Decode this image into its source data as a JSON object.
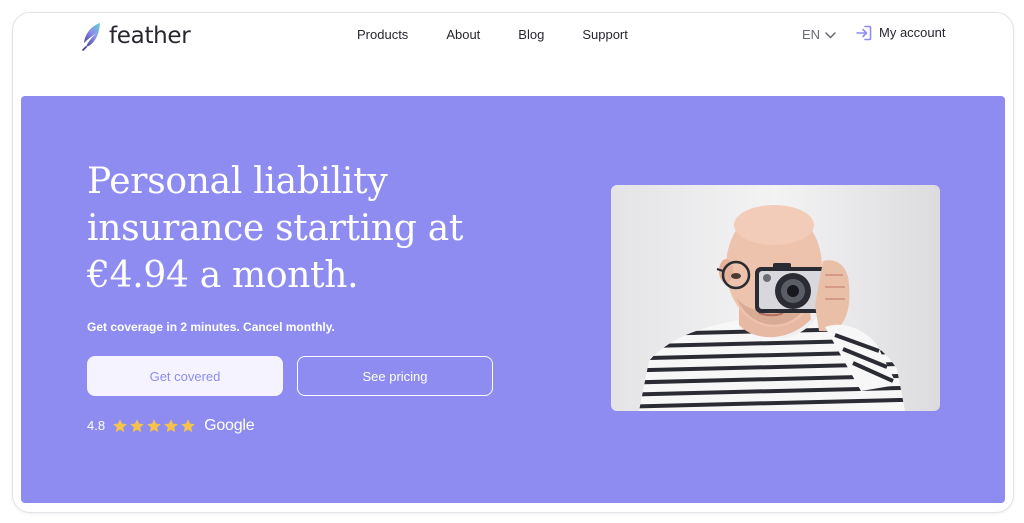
{
  "brand": {
    "name": "feather"
  },
  "nav": {
    "items": [
      {
        "label": "Products"
      },
      {
        "label": "About"
      },
      {
        "label": "Blog"
      },
      {
        "label": "Support"
      }
    ],
    "language": "EN",
    "account_label": "My account"
  },
  "hero": {
    "headline": "Personal liability insurance starting at €4.94 a month.",
    "subtitle": "Get coverage in 2 minutes. Cancel monthly.",
    "primary_button": "Get covered",
    "secondary_button": "See pricing",
    "rating": {
      "value": "4.8",
      "stars": 5,
      "source": "Google"
    },
    "image": {
      "subject": "man-with-camera-photo"
    }
  },
  "colors": {
    "brand_purple": "#8e8cf1",
    "hero_background": "#8e8cf1",
    "primary_button_bg": "#f4f3ff",
    "star": "#f5c24b",
    "text_dark": "#26262e"
  },
  "icons": [
    "feather-logo-icon",
    "chevron-down-icon",
    "sign-in-icon",
    "star-icon"
  ]
}
